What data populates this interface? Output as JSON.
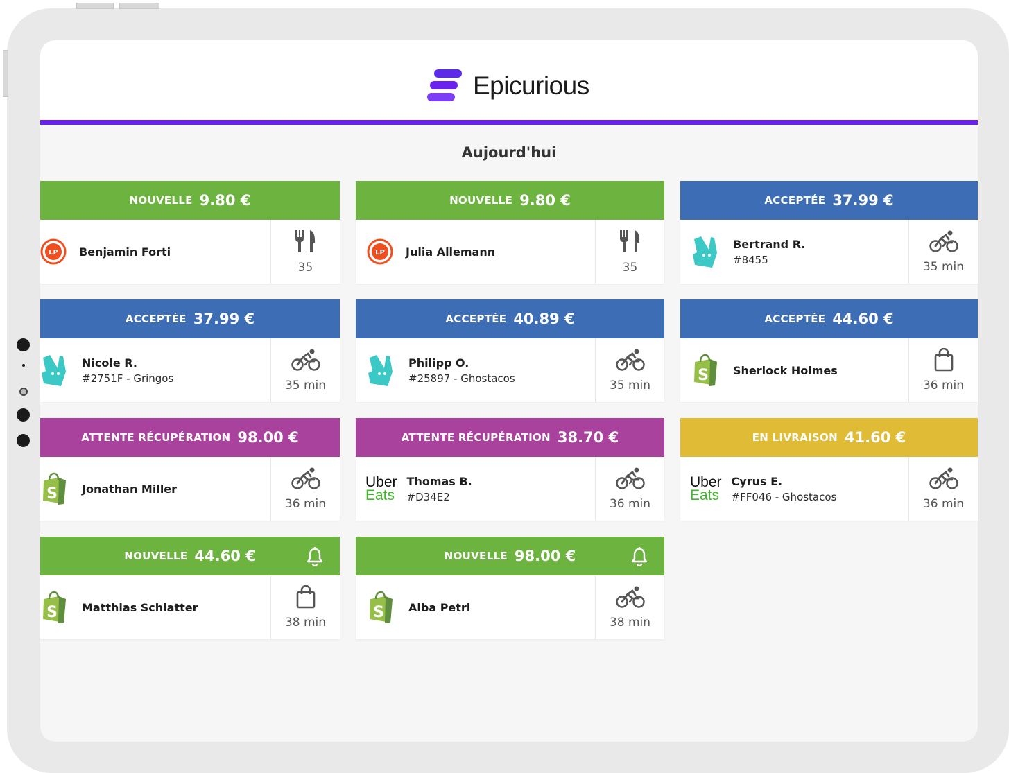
{
  "app": {
    "name": "Epicurious",
    "brand_color": "#6b21ee"
  },
  "section_title": "Aujourd'hui",
  "status_colors": {
    "nouvelle": "#6db33f",
    "acceptee": "#3d6db5",
    "attente": "#a8429c",
    "livraison": "#e0bb36"
  },
  "orders": [
    {
      "status": "NOUVELLE",
      "price": "9.80 €",
      "brand": "lp-icon",
      "name": "Benjamin Forti",
      "ref": "",
      "mode": "cutlery-icon",
      "detail": "35",
      "bell": false
    },
    {
      "status": "NOUVELLE",
      "price": "9.80 €",
      "brand": "lp-icon",
      "name": "Julia Allemann",
      "ref": "",
      "mode": "cutlery-icon",
      "detail": "35",
      "bell": false
    },
    {
      "status": "ACCEPTÉE",
      "price": "37.99 €",
      "brand": "deliveroo-icon",
      "name": "Bertrand R.",
      "ref": "#8455",
      "mode": "bike-icon",
      "detail": "35 min",
      "bell": false
    },
    {
      "status": "ACCEPTÉE",
      "price": "37.99 €",
      "brand": "deliveroo-icon",
      "name": "Nicole R.",
      "ref": "#2751F - Gringos",
      "mode": "bike-icon",
      "detail": "35 min",
      "bell": false
    },
    {
      "status": "ACCEPTÉE",
      "price": "40.89 €",
      "brand": "deliveroo-icon",
      "name": "Philipp O.",
      "ref": "#25897 - Ghostacos",
      "mode": "bike-icon",
      "detail": "35 min",
      "bell": false
    },
    {
      "status": "ACCEPTÉE",
      "price": "44.60 €",
      "brand": "shopify-icon",
      "name": "Sherlock Holmes",
      "ref": "",
      "mode": "bag-icon",
      "detail": "36 min",
      "bell": false
    },
    {
      "status": "ATTENTE RÉCUPÉRATION",
      "price": "98.00 €",
      "brand": "shopify-icon",
      "name": "Jonathan Miller",
      "ref": "",
      "mode": "bike-icon",
      "detail": "36 min",
      "bell": false
    },
    {
      "status": "ATTENTE RÉCUPÉRATION",
      "price": "38.70 €",
      "brand": "ubereats-icon",
      "name": "Thomas B.",
      "ref": "#D34E2",
      "mode": "bike-icon",
      "detail": "36 min",
      "bell": false
    },
    {
      "status": "EN LIVRAISON",
      "price": "41.60 €",
      "brand": "ubereats-icon",
      "name": "Cyrus E.",
      "ref": "#FF046 - Ghostacos",
      "mode": "bike-icon",
      "detail": "36 min",
      "bell": false
    },
    {
      "status": "NOUVELLE",
      "price": "44.60 €",
      "brand": "shopify-icon",
      "name": "Matthias Schlatter",
      "ref": "",
      "mode": "bag-icon",
      "detail": "38 min",
      "bell": true
    },
    {
      "status": "NOUVELLE",
      "price": "98.00 €",
      "brand": "shopify-icon",
      "name": "Alba Petri",
      "ref": "",
      "mode": "bike-icon",
      "detail": "38 min",
      "bell": true
    }
  ],
  "uber_eats": {
    "line1": "Uber",
    "line2": "Eats"
  },
  "lp_badge": "LP"
}
